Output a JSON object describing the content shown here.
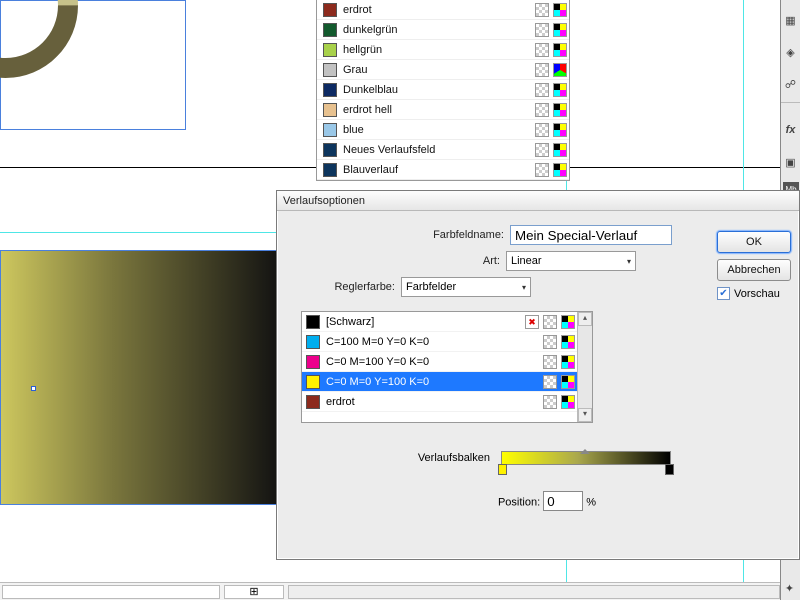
{
  "swatches": {
    "items": [
      {
        "name": "erdrot",
        "color": "#8c2a1d"
      },
      {
        "name": "dunkelgrün",
        "color": "#135a2e"
      },
      {
        "name": "hellgrün",
        "color": "#a8d14a"
      },
      {
        "name": "Grau",
        "color": "#c2c2c2"
      },
      {
        "name": "Dunkelblau",
        "color": "#0d2a63"
      },
      {
        "name": "erdrot hell",
        "color": "#e7c18f"
      },
      {
        "name": "blue",
        "color": "#9ac8e8"
      },
      {
        "name": "Neues Verlaufsfeld",
        "color": "#0d355d"
      },
      {
        "name": "Blauverlauf",
        "color": "#0d355d"
      }
    ]
  },
  "dialog": {
    "title": "Verlaufsoptionen",
    "field_name_label": "Farbfeldname:",
    "field_name_value": "Mein Special-Verlauf",
    "type_label": "Art:",
    "type_value": "Linear",
    "stopcolor_label": "Reglerfarbe:",
    "stopcolor_value": "Farbfelder",
    "color_list": [
      {
        "name": "[Schwarz]",
        "color": "#000000",
        "noedit": true
      },
      {
        "name": "C=100 M=0 Y=0 K=0",
        "color": "#00aeef"
      },
      {
        "name": "C=0 M=100 Y=0 K=0",
        "color": "#ec008c"
      },
      {
        "name": "C=0 M=0 Y=100 K=0",
        "color": "#fff200",
        "selected": true
      },
      {
        "name": "erdrot",
        "color": "#8c2a1d"
      }
    ],
    "ramp_label": "Verlaufsbalken",
    "position_label": "Position:",
    "position_value": "0",
    "position_unit": "%",
    "ok": "OK",
    "cancel": "Abbrechen",
    "preview": "Vorschau"
  },
  "right_panel_icons": [
    "pages-icon",
    "layers-icon",
    "links-icon",
    "divider",
    "fx-icon",
    "object-styles-icon",
    "mb-icon"
  ],
  "bottom_icons": [
    "add-page-icon"
  ]
}
